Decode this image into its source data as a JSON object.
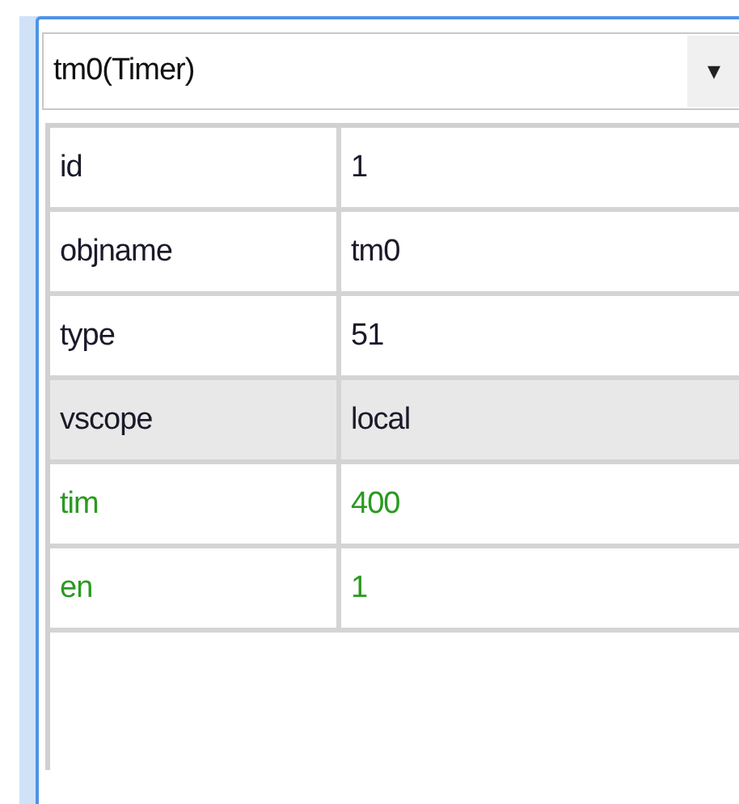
{
  "object_selector": {
    "value": "tm0(Timer)",
    "arrow": "▾"
  },
  "properties": [
    {
      "name": "id",
      "value": "1",
      "editable": false,
      "selected": false
    },
    {
      "name": "objname",
      "value": "tm0",
      "editable": false,
      "selected": false
    },
    {
      "name": "type",
      "value": "51",
      "editable": false,
      "selected": false
    },
    {
      "name": "vscope",
      "value": "local",
      "editable": false,
      "selected": true
    },
    {
      "name": "tim",
      "value": "400",
      "editable": true,
      "selected": false
    },
    {
      "name": "en",
      "value": "1",
      "editable": true,
      "selected": false
    }
  ]
}
